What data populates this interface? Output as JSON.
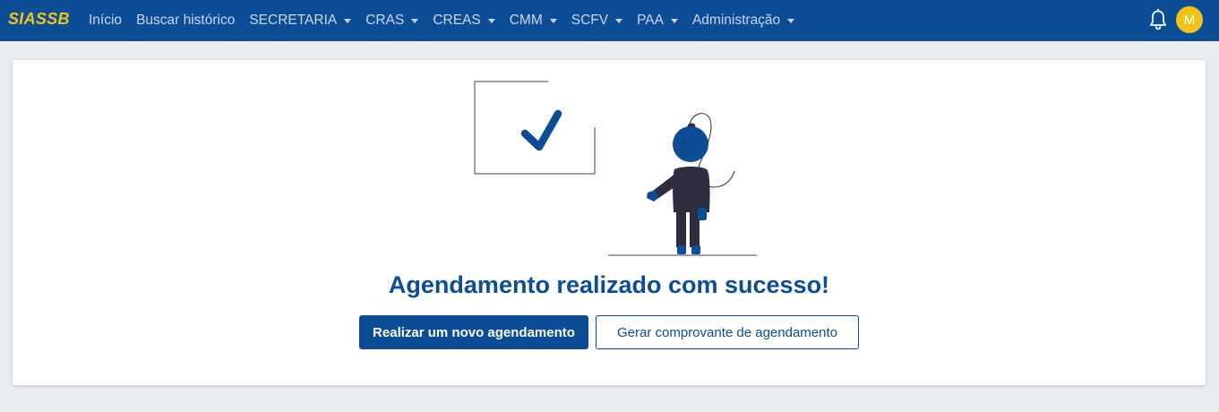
{
  "navbar": {
    "brand": "SIASSB",
    "items": [
      {
        "label": "Início",
        "dropdown": false
      },
      {
        "label": "Buscar histórico",
        "dropdown": false
      },
      {
        "label": "SECRETARIA",
        "dropdown": true
      },
      {
        "label": "CRAS",
        "dropdown": true
      },
      {
        "label": "CREAS",
        "dropdown": true
      },
      {
        "label": "CMM",
        "dropdown": true
      },
      {
        "label": "SCFV",
        "dropdown": true
      },
      {
        "label": "PAA",
        "dropdown": true
      },
      {
        "label": "Administração",
        "dropdown": true
      }
    ],
    "notification_icon": "bell-icon",
    "avatar_initial": "M"
  },
  "main": {
    "heading": "Agendamento realizado com sucesso!",
    "primary_button": "Realizar um novo agendamento",
    "secondary_button": "Gerar comprovante de agendamento",
    "illustration": "person-with-checkmark-illustration"
  },
  "colors": {
    "navbar": "#0c4d96",
    "brand": "#f0c419",
    "accent": "#0c4d96",
    "figure_dark": "#2f2e41"
  }
}
